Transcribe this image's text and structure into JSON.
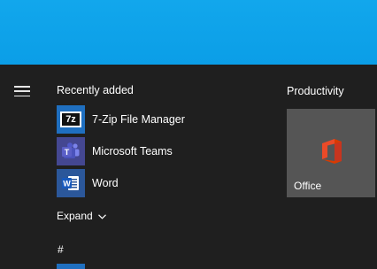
{
  "start_menu": {
    "menu_icon": "hamburger-icon",
    "recently_added": {
      "title": "Recently added",
      "items": [
        {
          "label": "7-Zip File Manager",
          "icon": "7zip-icon",
          "icon_text": "7z",
          "color": "#1f6fc0"
        },
        {
          "label": "Microsoft Teams",
          "icon": "teams-icon",
          "icon_text": "T",
          "color": "#444791"
        },
        {
          "label": "Word",
          "icon": "word-icon",
          "icon_text": "W",
          "color": "#2b579a"
        }
      ]
    },
    "expand": {
      "label": "Expand",
      "icon": "chevron-down-icon"
    },
    "alpha_header": "#",
    "productivity": {
      "title": "Productivity",
      "tiles": [
        {
          "label": "Office",
          "icon": "office-icon",
          "color": "#555555"
        }
      ]
    }
  },
  "colors": {
    "desktop": "#0ea3ea",
    "menu_bg": "#1f1f1f",
    "tile_bg": "#555555",
    "office_accent": "#e0361c"
  }
}
